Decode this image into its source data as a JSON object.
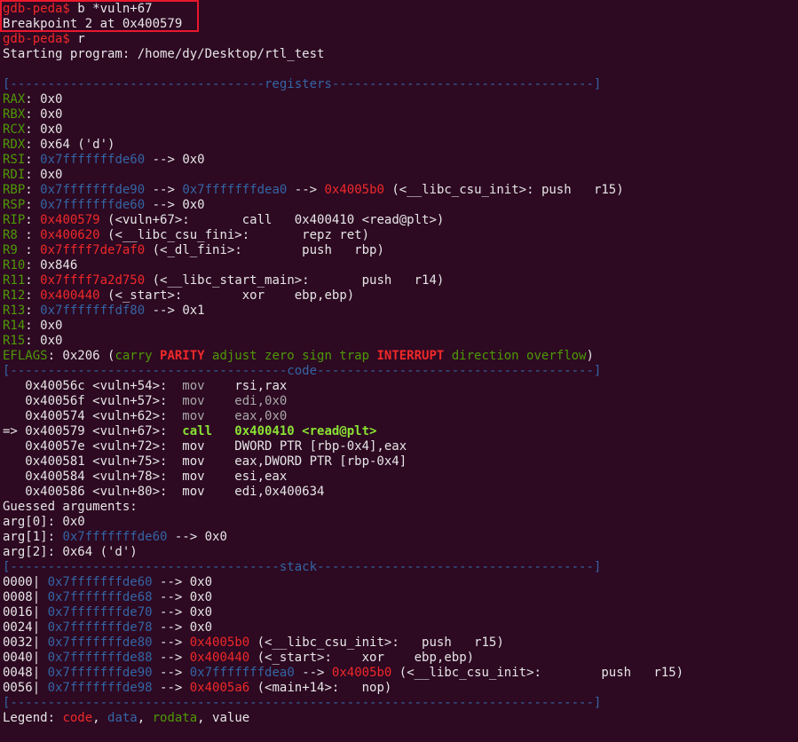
{
  "colors": {
    "background": "#2d0922",
    "text": "#e6e6e6",
    "red": "#ef2929",
    "green": "#8ae234",
    "dark_green": "#4e9a06",
    "blue": "#3465a4",
    "gray": "#a8a8a8",
    "highlight_box": "#e8182c"
  },
  "lines": [
    [
      [
        "r",
        "gdb-peda$ "
      ],
      [
        "w",
        "b *vuln+67"
      ]
    ],
    [
      [
        "w",
        "Breakpoint 2 at 0x400579"
      ]
    ],
    [
      [
        "r",
        "gdb-peda$ "
      ],
      [
        "w",
        "r"
      ]
    ],
    [
      [
        "w",
        "Starting program: /home/dy/Desktop/rtl_test"
      ]
    ],
    [],
    [
      [
        "b",
        "[----------------------------------registers-----------------------------------]"
      ]
    ],
    [
      [
        "G",
        "RAX"
      ],
      [
        "w",
        ": 0x0"
      ]
    ],
    [
      [
        "G",
        "RBX"
      ],
      [
        "w",
        ": 0x0"
      ]
    ],
    [
      [
        "G",
        "RCX"
      ],
      [
        "w",
        ": 0x0"
      ]
    ],
    [
      [
        "G",
        "RDX"
      ],
      [
        "w",
        ": 0x64 ('d')"
      ]
    ],
    [
      [
        "G",
        "RSI"
      ],
      [
        "w",
        ": "
      ],
      [
        "b",
        "0x7fffffffde60"
      ],
      [
        "w",
        " --> 0x0"
      ]
    ],
    [
      [
        "G",
        "RDI"
      ],
      [
        "w",
        ": 0x0"
      ]
    ],
    [
      [
        "G",
        "RBP"
      ],
      [
        "w",
        ": "
      ],
      [
        "b",
        "0x7fffffffde90"
      ],
      [
        "w",
        " --> "
      ],
      [
        "b",
        "0x7fffffffdea0"
      ],
      [
        "w",
        " --> "
      ],
      [
        "r",
        "0x4005b0"
      ],
      [
        "w",
        " (<__libc_csu_init>: push   r15)"
      ]
    ],
    [
      [
        "G",
        "RSP"
      ],
      [
        "w",
        ": "
      ],
      [
        "b",
        "0x7fffffffde60"
      ],
      [
        "w",
        " --> 0x0"
      ]
    ],
    [
      [
        "G",
        "RIP"
      ],
      [
        "w",
        ": "
      ],
      [
        "r",
        "0x400579"
      ],
      [
        "w",
        " (<vuln+67>:       call   0x400410 <read@plt>)"
      ]
    ],
    [
      [
        "G",
        "R8 "
      ],
      [
        "w",
        ": "
      ],
      [
        "r",
        "0x400620"
      ],
      [
        "w",
        " (<__libc_csu_fini>:       repz ret)"
      ]
    ],
    [
      [
        "G",
        "R9 "
      ],
      [
        "w",
        ": "
      ],
      [
        "r",
        "0x7ffff7de7af0"
      ],
      [
        "w",
        " (<_dl_fini>:        push   rbp)"
      ]
    ],
    [
      [
        "G",
        "R10"
      ],
      [
        "w",
        ": 0x846"
      ]
    ],
    [
      [
        "G",
        "R11"
      ],
      [
        "w",
        ": "
      ],
      [
        "r",
        "0x7ffff7a2d750"
      ],
      [
        "w",
        " (<__libc_start_main>:       push   r14)"
      ]
    ],
    [
      [
        "G",
        "R12"
      ],
      [
        "w",
        ": "
      ],
      [
        "r",
        "0x400440"
      ],
      [
        "w",
        " (<_start>:        xor    ebp,ebp)"
      ]
    ],
    [
      [
        "G",
        "R13"
      ],
      [
        "w",
        ": "
      ],
      [
        "b",
        "0x7fffffffdf80"
      ],
      [
        "w",
        " --> 0x1"
      ]
    ],
    [
      [
        "G",
        "R14"
      ],
      [
        "w",
        ": 0x0"
      ]
    ],
    [
      [
        "G",
        "R15"
      ],
      [
        "w",
        ": 0x0"
      ]
    ],
    [
      [
        "G",
        "EFLAGS"
      ],
      [
        "w",
        ": 0x206 ("
      ],
      [
        "G",
        "carry "
      ],
      [
        "rb",
        "PARITY"
      ],
      [
        "G",
        " adjust zero sign trap "
      ],
      [
        "rb",
        "INTERRUPT"
      ],
      [
        "G",
        " direction overflow"
      ],
      [
        "w",
        ")"
      ]
    ],
    [
      [
        "b",
        "[-------------------------------------code-------------------------------------]"
      ]
    ],
    [
      [
        "w",
        "   0x40056c <vuln+54>:  "
      ],
      [
        "gr",
        "mov    "
      ],
      [
        "w",
        "rsi,rax"
      ]
    ],
    [
      [
        "w",
        "   0x40056f <vuln+57>:  "
      ],
      [
        "gr",
        "mov    edi,0x0"
      ]
    ],
    [
      [
        "w",
        "   0x400574 <vuln+62>:  "
      ],
      [
        "gr",
        "mov    eax,0x0"
      ]
    ],
    [
      [
        "w",
        "=> 0x400579 <vuln+67>:  "
      ],
      [
        "gb",
        "call   0x400410 <read@plt>"
      ]
    ],
    [
      [
        "w",
        "   0x40057e <vuln+72>:  mov    DWORD PTR [rbp-0x4],eax"
      ]
    ],
    [
      [
        "w",
        "   0x400581 <vuln+75>:  mov    eax,DWORD PTR [rbp-0x4]"
      ]
    ],
    [
      [
        "w",
        "   0x400584 <vuln+78>:  mov    esi,eax"
      ]
    ],
    [
      [
        "w",
        "   0x400586 <vuln+80>:  mov    edi,0x400634"
      ]
    ],
    [
      [
        "w",
        "Guessed arguments:"
      ]
    ],
    [
      [
        "w",
        "arg[0]: 0x0"
      ]
    ],
    [
      [
        "w",
        "arg[1]: "
      ],
      [
        "b",
        "0x7fffffffde60"
      ],
      [
        "w",
        " --> 0x0"
      ]
    ],
    [
      [
        "w",
        "arg[2]: 0x64 ('d')"
      ]
    ],
    [
      [
        "b",
        "[------------------------------------stack-------------------------------------]"
      ]
    ],
    [
      [
        "w",
        "0000| "
      ],
      [
        "b",
        "0x7fffffffde60"
      ],
      [
        "w",
        " --> 0x0"
      ]
    ],
    [
      [
        "w",
        "0008| "
      ],
      [
        "b",
        "0x7fffffffde68"
      ],
      [
        "w",
        " --> 0x0"
      ]
    ],
    [
      [
        "w",
        "0016| "
      ],
      [
        "b",
        "0x7fffffffde70"
      ],
      [
        "w",
        " --> 0x0"
      ]
    ],
    [
      [
        "w",
        "0024| "
      ],
      [
        "b",
        "0x7fffffffde78"
      ],
      [
        "w",
        " --> 0x0"
      ]
    ],
    [
      [
        "w",
        "0032| "
      ],
      [
        "b",
        "0x7fffffffde80"
      ],
      [
        "w",
        " --> "
      ],
      [
        "r",
        "0x4005b0"
      ],
      [
        "w",
        " (<__libc_csu_init>:   push   r15)"
      ]
    ],
    [
      [
        "w",
        "0040| "
      ],
      [
        "b",
        "0x7fffffffde88"
      ],
      [
        "w",
        " --> "
      ],
      [
        "r",
        "0x400440"
      ],
      [
        "w",
        " (<_start>:    xor    ebp,ebp)"
      ]
    ],
    [
      [
        "w",
        "0048| "
      ],
      [
        "b",
        "0x7fffffffde90"
      ],
      [
        "w",
        " --> "
      ],
      [
        "b",
        "0x7fffffffdea0"
      ],
      [
        "w",
        " --> "
      ],
      [
        "r",
        "0x4005b0"
      ],
      [
        "w",
        " (<__libc_csu_init>:        push   r15)"
      ]
    ],
    [
      [
        "w",
        "0056| "
      ],
      [
        "b",
        "0x7fffffffde98"
      ],
      [
        "w",
        " --> "
      ],
      [
        "r",
        "0x4005a6"
      ],
      [
        "w",
        " (<main+14>:   nop)"
      ]
    ],
    [
      [
        "b",
        "[------------------------------------------------------------------------------]"
      ]
    ],
    [
      [
        "w",
        "Legend: "
      ],
      [
        "r",
        "code"
      ],
      [
        "w",
        ", "
      ],
      [
        "b",
        "data"
      ],
      [
        "w",
        ", "
      ],
      [
        "G",
        "rodata"
      ],
      [
        "w",
        ", value"
      ]
    ]
  ]
}
